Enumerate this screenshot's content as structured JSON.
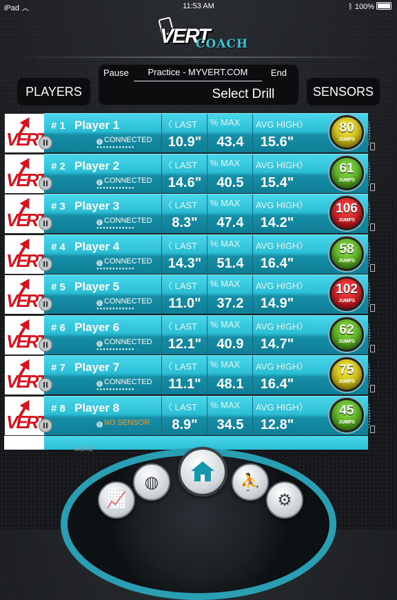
{
  "status_bar": {
    "device": "iPad",
    "time": "11:53 AM",
    "battery": "100%"
  },
  "logo": {
    "vert": "VERT",
    "coach": "COACH"
  },
  "header": {
    "players_label": "PLAYERS",
    "sensors_label": "SENSORS",
    "pause_label": "Pause",
    "practice_label": "Practice - MYVERT.COM",
    "end_label": "End",
    "select_drill_label": "Select Drill"
  },
  "columns": {
    "last": "〈 LAST",
    "max": "% MAX",
    "avg": "AVG HIGH〉"
  },
  "players": [
    {
      "num": "# 1",
      "name": "Player 1",
      "status": "CONNECTED",
      "last": "10.9\"",
      "max": "43.4",
      "avg": "15.6\"",
      "jumps": "80",
      "color": "yellow"
    },
    {
      "num": "# 2",
      "name": "Player 2",
      "status": "CONNECTED",
      "last": "14.6\"",
      "max": "40.5",
      "avg": "15.4\"",
      "jumps": "61",
      "color": "green"
    },
    {
      "num": "# 3",
      "name": "Player 3",
      "status": "CONNECTED",
      "last": "8.3\"",
      "max": "47.4",
      "avg": "14.2\"",
      "jumps": "106",
      "color": "red"
    },
    {
      "num": "# 4",
      "name": "Player 4",
      "status": "CONNECTED",
      "last": "14.3\"",
      "max": "51.4",
      "avg": "16.4\"",
      "jumps": "58",
      "color": "green"
    },
    {
      "num": "# 5",
      "name": "Player 5",
      "status": "CONNECTED",
      "last": "11.0\"",
      "max": "37.2",
      "avg": "14.9\"",
      "jumps": "102",
      "color": "red"
    },
    {
      "num": "# 6",
      "name": "Player 6",
      "status": "CONNECTED",
      "last": "12.1\"",
      "max": "40.9",
      "avg": "14.7\"",
      "jumps": "62",
      "color": "green"
    },
    {
      "num": "# 7",
      "name": "Player 7",
      "status": "CONNECTED",
      "last": "11.1\"",
      "max": "48.1",
      "avg": "16.4\"",
      "jumps": "75",
      "color": "yellow"
    },
    {
      "num": "# 8",
      "name": "Player 8",
      "status": "NO SENSOR",
      "last": "8.9\"",
      "max": "34.5",
      "avg": "12.8\"",
      "jumps": "45",
      "color": "green"
    }
  ],
  "jumps_label": "JUMPS",
  "more_label": "MORE",
  "dock_icons": [
    "stats-icon",
    "volleyball-icon",
    "home-icon",
    "jumper-icon",
    "gear-icon"
  ],
  "colors": {
    "accent": "#2bbfd6",
    "brand_red": "#d8121c",
    "warn": "#ff9a1f"
  }
}
